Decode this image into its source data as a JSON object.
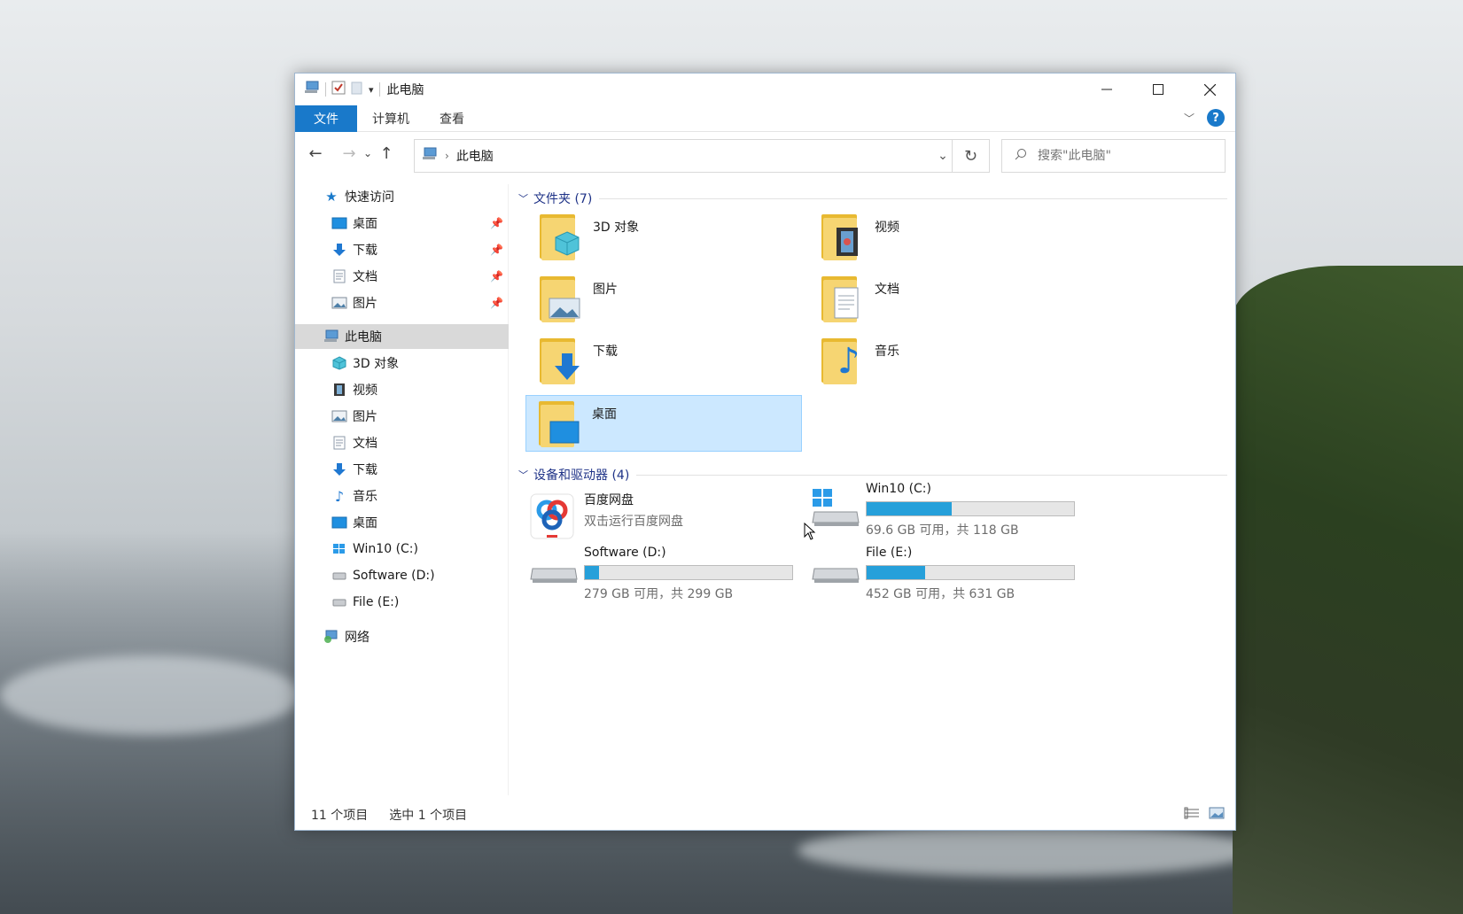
{
  "window": {
    "title": "此电脑",
    "minimize_icon": "minimize-icon",
    "maximize_icon": "maximize-icon",
    "close_icon": "close-icon"
  },
  "ribbon": {
    "file_tab": "文件",
    "tabs": [
      "计算机",
      "查看"
    ]
  },
  "address": {
    "location": "此电脑",
    "search_placeholder": "搜索\"此电脑\""
  },
  "nav_pane": {
    "quick_access": "快速访问",
    "quick_items": [
      "桌面",
      "下载",
      "文档",
      "图片"
    ],
    "this_pc": "此电脑",
    "pc_items": [
      "3D 对象",
      "视频",
      "图片",
      "文档",
      "下载",
      "音乐",
      "桌面",
      "Win10 (C:)",
      "Software (D:)",
      "File (E:)"
    ],
    "network": "网络"
  },
  "folders": {
    "header": "文件夹 (7)",
    "items": [
      "3D 对象",
      "视频",
      "图片",
      "文档",
      "下载",
      "音乐",
      "桌面"
    ],
    "selected": "桌面"
  },
  "devices": {
    "header": "设备和驱动器 (4)",
    "baidu": {
      "name": "百度网盘",
      "subtitle": "双击运行百度网盘"
    },
    "drives": [
      {
        "name": "Win10 (C:)",
        "size_text": "69.6 GB 可用，共 118 GB",
        "used_fraction": 0.41
      },
      {
        "name": "Software (D:)",
        "size_text": "279 GB 可用，共 299 GB",
        "used_fraction": 0.07
      },
      {
        "name": "File (E:)",
        "size_text": "452 GB 可用，共 631 GB",
        "used_fraction": 0.28
      }
    ]
  },
  "status": {
    "count": "11 个项目",
    "selected": "选中 1 个项目"
  },
  "colors": {
    "accent": "#1979ca",
    "selection": "#cce8ff",
    "drive_bar": "#26a0da"
  }
}
